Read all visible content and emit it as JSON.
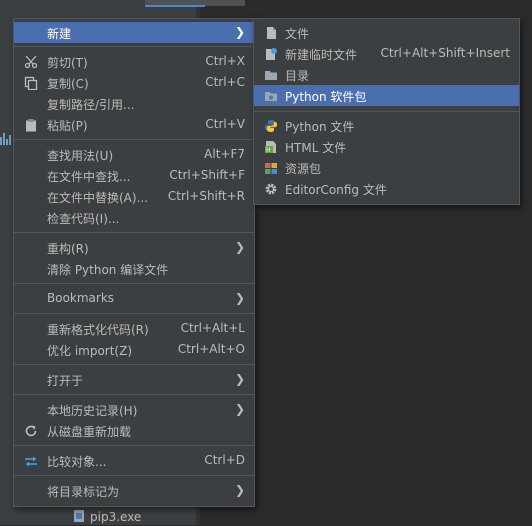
{
  "background": {
    "file_name": "pip3.exe"
  },
  "context_menu": {
    "items": [
      {
        "label": "新建",
        "shortcut": ""
      },
      {
        "label": "剪切(T)",
        "shortcut": "Ctrl+X"
      },
      {
        "label": "复制(C)",
        "shortcut": "Ctrl+C"
      },
      {
        "label": "复制路径/引用...",
        "shortcut": ""
      },
      {
        "label": "粘贴(P)",
        "shortcut": "Ctrl+V"
      },
      {
        "label": "查找用法(U)",
        "shortcut": "Alt+F7"
      },
      {
        "label": "在文件中查找...",
        "shortcut": "Ctrl+Shift+F"
      },
      {
        "label": "在文件中替换(A)...",
        "shortcut": "Ctrl+Shift+R"
      },
      {
        "label": "检查代码(I)...",
        "shortcut": ""
      },
      {
        "label": "重构(R)",
        "shortcut": ""
      },
      {
        "label": "清除 Python 编译文件",
        "shortcut": ""
      },
      {
        "label": "Bookmarks",
        "shortcut": ""
      },
      {
        "label": "重新格式化代码(R)",
        "shortcut": "Ctrl+Alt+L"
      },
      {
        "label": "优化 import(Z)",
        "shortcut": "Ctrl+Alt+O"
      },
      {
        "label": "打开于",
        "shortcut": ""
      },
      {
        "label": "本地历史记录(H)",
        "shortcut": ""
      },
      {
        "label": "从磁盘重新加载",
        "shortcut": ""
      },
      {
        "label": "比较对象...",
        "shortcut": "Ctrl+D"
      },
      {
        "label": "将目录标记为",
        "shortcut": ""
      }
    ]
  },
  "new_submenu": {
    "items": [
      {
        "label": "文件",
        "shortcut": ""
      },
      {
        "label": "新建临时文件",
        "shortcut": "Ctrl+Alt+Shift+Insert"
      },
      {
        "label": "目录",
        "shortcut": ""
      },
      {
        "label": "Python 软件包",
        "shortcut": ""
      },
      {
        "label": "Python 文件",
        "shortcut": ""
      },
      {
        "label": "HTML 文件",
        "shortcut": ""
      },
      {
        "label": "资源包",
        "shortcut": ""
      },
      {
        "label": "EditorConfig 文件",
        "shortcut": ""
      }
    ]
  },
  "colors": {
    "menu_bg": "#3c3f41",
    "selection": "#4b6eaf",
    "text": "#bbbbbb",
    "separator": "#515658"
  }
}
